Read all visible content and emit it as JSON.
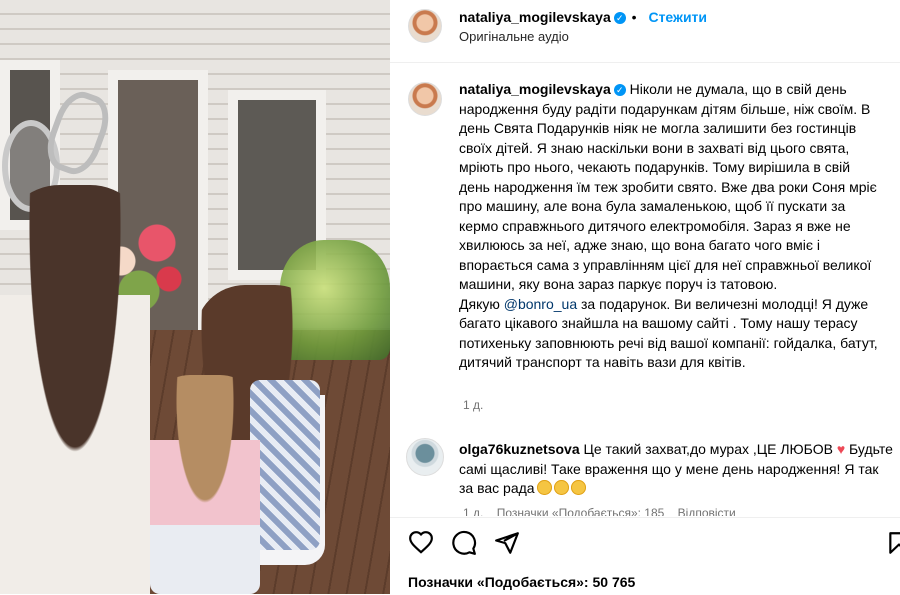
{
  "header": {
    "username": "nataliya_mogilevskaya",
    "follow_label": "Стежити",
    "separator": "•",
    "audio": "Оригінальне аудіо"
  },
  "caption": {
    "username": "nataliya_mogilevskaya",
    "p1": "Ніколи не думала, що в свій день народження буду радіти подарункам дітям більше, ніж своїм. В день Свята Подарунків ніяк не могла залишити без гостинців своїх дітей. Я знаю наскільки вони в захваті від цього свята, мріють про нього, чекають подарунків. Тому вирішила в свій день народження їм теж зробити свято. Вже два роки Соня мріє про машину, але вона була замаленькою, щоб її пускати за кермо справжнього дитячого електромобіля. Зараз я вже не хвилююсь за неї, адже знаю, що вона багато чого вміє і впорається сама з управлінням цієї для неї справжньої великої машини, яку вона зараз паркує поруч із татовою.",
    "p2_before": "Дякую ",
    "mention": "@bonro_ua",
    "p2_after": " за подарунок. Ви величезні молодці! Я дуже багато цікавого знайшла на вашому сайті . Тому нашу терасу потихеньку заповнюють речі від вашої компанії: гойдалка, батут, дитячий транспорт та навіть вази для квітів.",
    "time": "1 д."
  },
  "comment": {
    "username": "olga76kuznetsova",
    "text": "Це такий захват,до мурах ,ЦЕ ЛЮБОВ",
    "heart": "♥",
    "text2": "Будьте самі щасливі! Таке враження що у мене день народження! Я так за вас рада",
    "time": "1 д.",
    "likes": "Позначки «Подобається»: 185",
    "reply": "Відповісти"
  },
  "footer": {
    "likes": "Позначки «Подобається»: 50 765"
  },
  "colors": {
    "accent": "#0095f6",
    "heart": "#ed4956",
    "muted": "#737373"
  }
}
